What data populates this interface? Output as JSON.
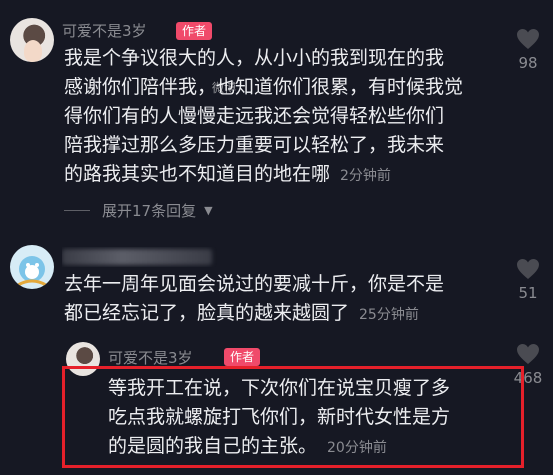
{
  "comments": [
    {
      "username": "可爱不是3岁",
      "badge": "作者",
      "line1": "我是个争议很大的人，从小小的我到现在的我",
      "line2": "感谢你们陪伴我，也知道你们很累，有时候我觉",
      "line3": "得你们有的人慢慢走远我还会觉得轻松些你们",
      "line4": "陪我撑过那么多压力重要可以轻松了，我未来",
      "line5": "的路我其实也不知道目的地在哪",
      "time": "2分钟前",
      "likes": "98"
    },
    {
      "username": "",
      "line1": "去年一周年见面会说过的要减十斤，你是不是",
      "line2": "都已经忘记了，脸真的越来越圆了",
      "time": "25分钟前",
      "likes": "51"
    },
    {
      "username": "可爱不是3岁",
      "badge": "作者",
      "line1": "等我开工在说，下次你们在说宝贝瘦了多",
      "line2": "吃点我就螺旋打飞你们，新时代女性是方",
      "line3": "的是圆的我自己的主张。",
      "time": "20分钟前",
      "likes": "468"
    }
  ],
  "expand_replies": "展开17条回复",
  "watermark": "微博",
  "colors": {
    "background": "#161823",
    "badge": "#f04a6a",
    "highlight": "#e6202a"
  },
  "icons": {
    "like": "heart-icon",
    "expand": "chevron-down-icon"
  }
}
